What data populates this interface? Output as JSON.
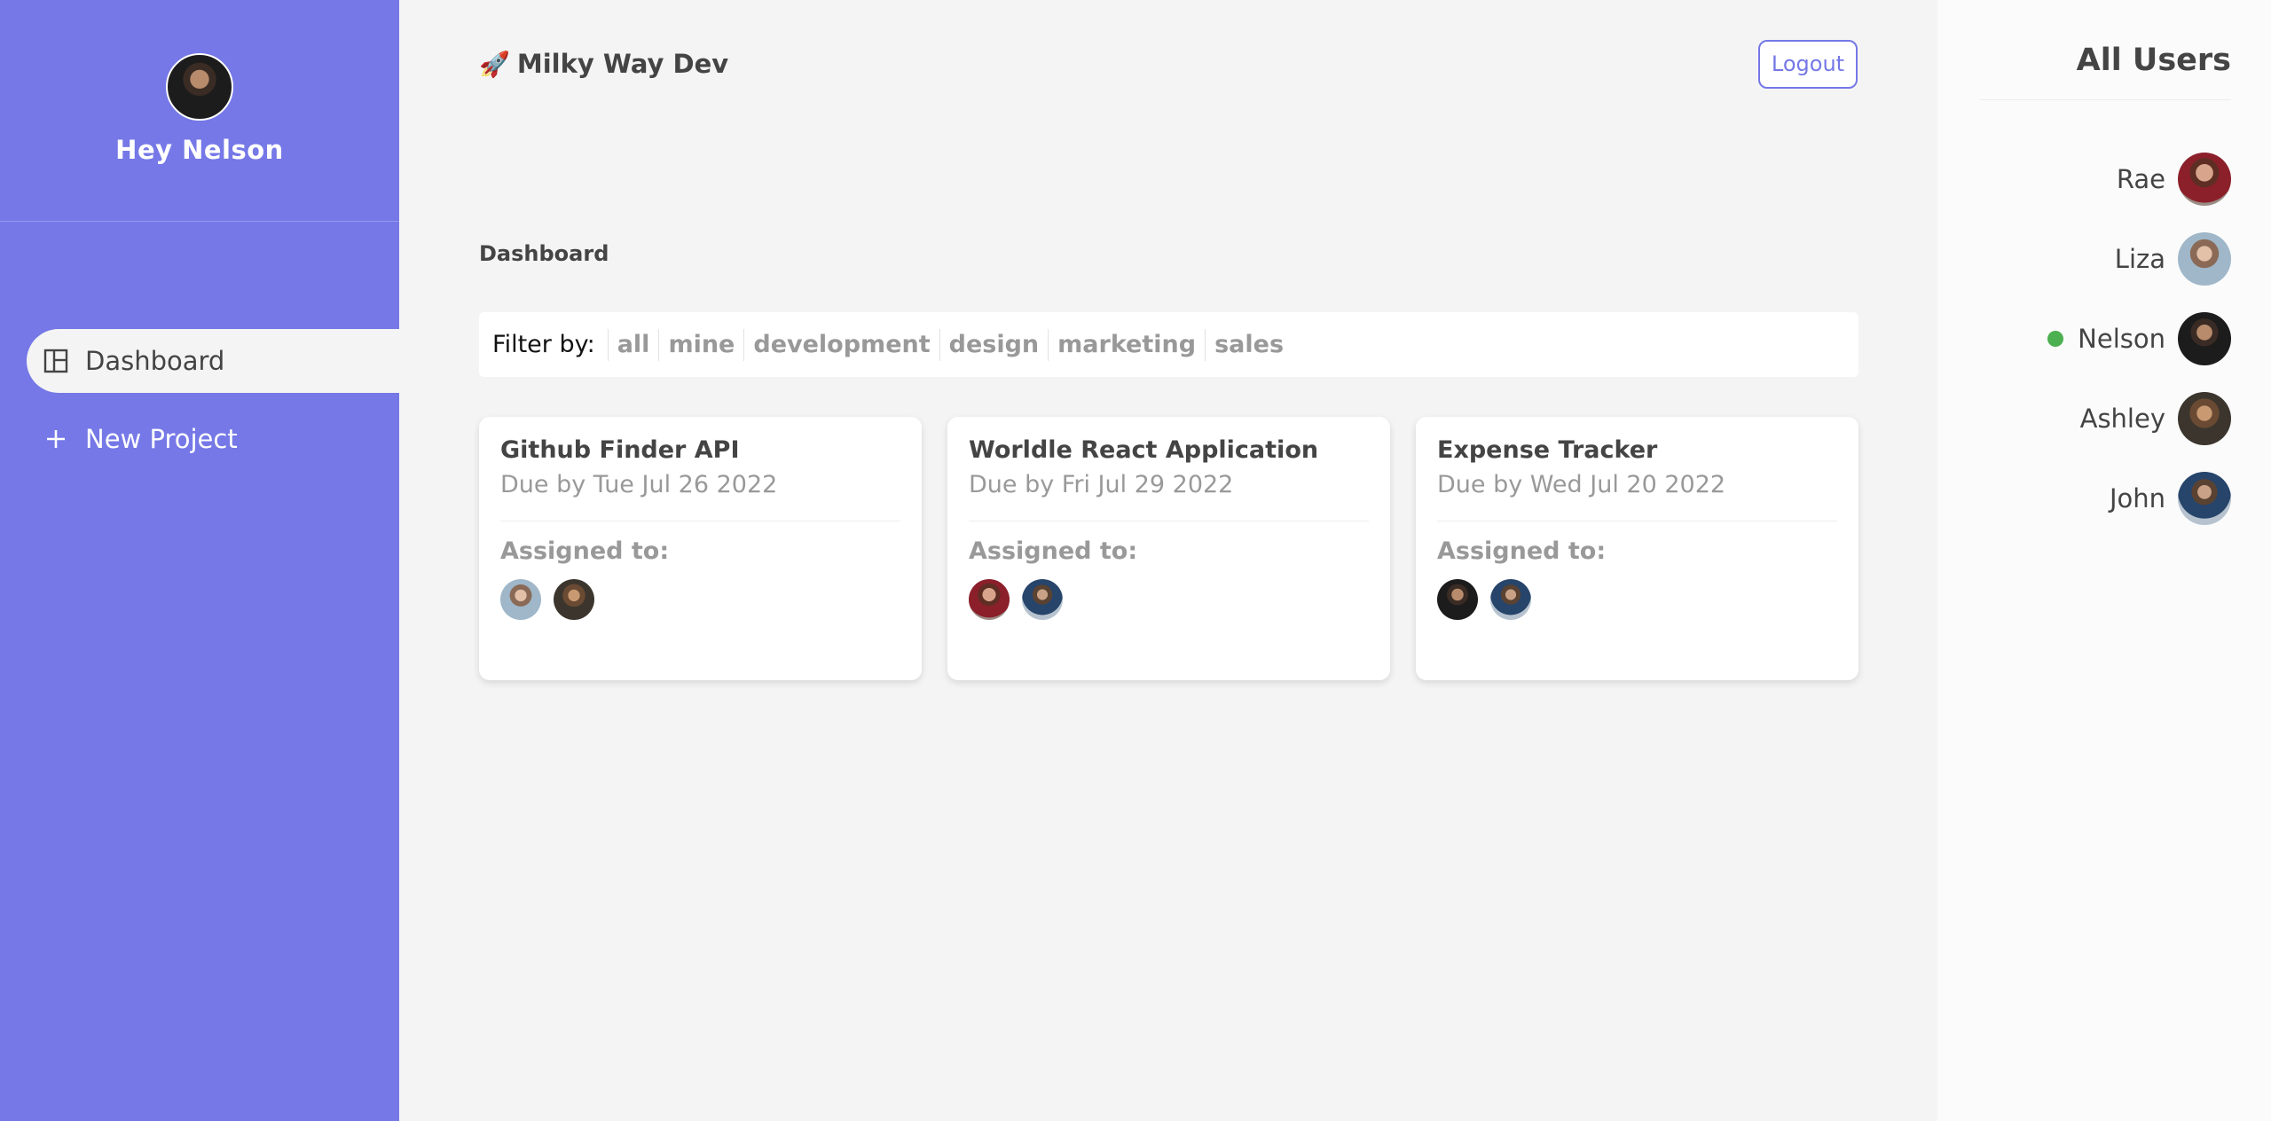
{
  "sidebar": {
    "greeting": "Hey Nelson",
    "nav": [
      {
        "label": "Dashboard",
        "icon": "dashboard-icon",
        "active": true
      },
      {
        "label": "New Project",
        "icon": "plus-icon",
        "active": false
      }
    ]
  },
  "header": {
    "brand": "Milky Way Dev",
    "brand_icon": "🚀",
    "logout_label": "Logout"
  },
  "main": {
    "title": "Dashboard",
    "filter": {
      "label": "Filter by:",
      "options": [
        "all",
        "mine",
        "development",
        "design",
        "marketing",
        "sales"
      ]
    },
    "projects": [
      {
        "name": "Github Finder API",
        "due": "Due by Tue Jul 26 2022",
        "assigned_label": "Assigned to:",
        "assignees": [
          "liza",
          "ashley"
        ]
      },
      {
        "name": "Worldle React Application",
        "due": "Due by Fri Jul 29 2022",
        "assigned_label": "Assigned to:",
        "assignees": [
          "rae",
          "john"
        ]
      },
      {
        "name": "Expense Tracker",
        "due": "Due by Wed Jul 20 2022",
        "assigned_label": "Assigned to:",
        "assignees": [
          "nelson",
          "john"
        ]
      }
    ]
  },
  "users_panel": {
    "title": "All Users",
    "users": [
      {
        "name": "Rae",
        "online": false
      },
      {
        "name": "Liza",
        "online": false
      },
      {
        "name": "Nelson",
        "online": true
      },
      {
        "name": "Ashley",
        "online": false
      },
      {
        "name": "John",
        "online": false
      }
    ]
  },
  "colors": {
    "accent": "#7578e6",
    "background": "#f4f4f4",
    "online": "#4caf50"
  }
}
